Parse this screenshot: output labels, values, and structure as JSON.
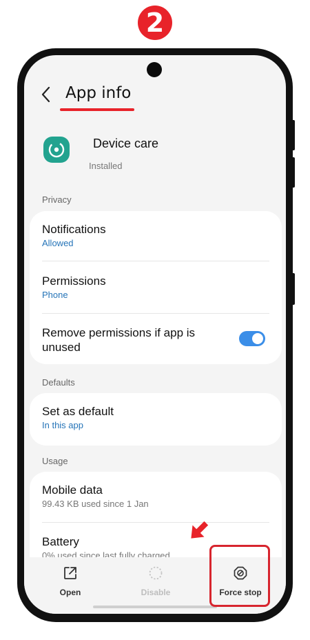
{
  "annotation": {
    "step_number": "2",
    "accent_color": "#e8232a"
  },
  "header": {
    "title": "App info"
  },
  "app": {
    "name": "Device care",
    "status": "Installed",
    "icon_color": "#22a38f"
  },
  "sections": {
    "privacy": "Privacy",
    "defaults": "Defaults",
    "usage": "Usage"
  },
  "items": {
    "notifications": {
      "title": "Notifications",
      "subtitle": "Allowed"
    },
    "permissions": {
      "title": "Permissions",
      "subtitle": "Phone"
    },
    "remove_permissions": {
      "title": "Remove permissions if app is unused",
      "enabled": true
    },
    "set_as_default": {
      "title": "Set as default",
      "subtitle": "In this app"
    },
    "mobile_data": {
      "title": "Mobile data",
      "subtitle": "99.43 KB used since 1 Jan"
    },
    "battery": {
      "title": "Battery",
      "subtitle": "0% used since last fully charged"
    }
  },
  "bottom_bar": {
    "open": "Open",
    "disable": "Disable",
    "force_stop": "Force stop"
  },
  "colors": {
    "link": "#2574b8",
    "toggle_on": "#3b8ee8"
  },
  "icons": [
    "back-icon",
    "device-care-icon",
    "open-external-icon",
    "disable-icon",
    "force-stop-icon",
    "arrow-icon"
  ]
}
